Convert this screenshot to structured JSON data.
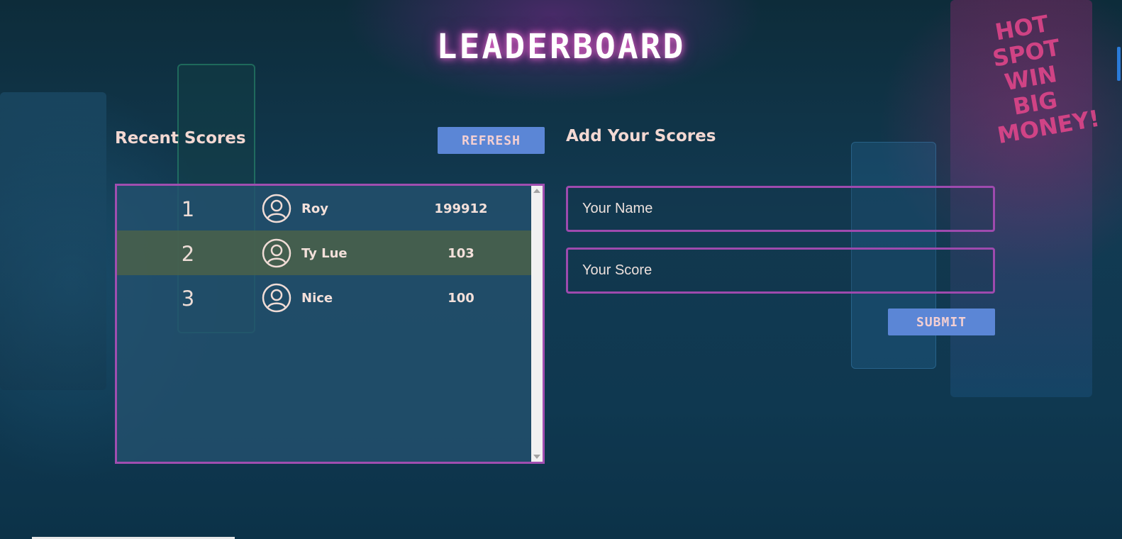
{
  "page": {
    "title": "LEADERBOARD"
  },
  "recent": {
    "label": "Recent Scores",
    "refresh_label": "REFRESH",
    "entries": [
      {
        "rank": "1",
        "name": "Roy",
        "score": "199912",
        "highlight": false
      },
      {
        "rank": "2",
        "name": "Ty Lue",
        "score": "103",
        "highlight": true
      },
      {
        "rank": "3",
        "name": "Nice",
        "score": "100",
        "highlight": false
      }
    ]
  },
  "add": {
    "label": "Add Your Scores",
    "name_placeholder": "Your Name",
    "score_placeholder": "Your Score",
    "submit_label": "SUBMIT"
  },
  "background": {
    "sign_text": "HOT SPOT WIN BIG MONEY!"
  },
  "colors": {
    "accent_border": "#a04eb0",
    "button": "#5b86d6",
    "highlight_row": "#50644a"
  },
  "icons": {
    "avatar": "user-circle-icon"
  }
}
